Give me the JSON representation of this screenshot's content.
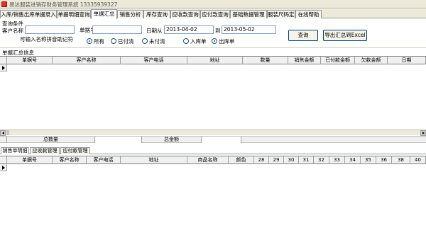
{
  "window": {
    "title": "易达服装进销存财务管理系统 13335939327"
  },
  "tabs": [
    {
      "label": "入库/销售出库单据录入",
      "active": false
    },
    {
      "label": "单据明细查询",
      "active": false
    },
    {
      "label": "单据汇总",
      "active": true
    },
    {
      "label": "销售分析",
      "active": false
    },
    {
      "label": "库存查询",
      "active": false
    },
    {
      "label": "应收款查询",
      "active": false
    },
    {
      "label": "应付款查询",
      "active": false
    },
    {
      "label": "基础数据管理",
      "active": false
    },
    {
      "label": "服装尺码定义",
      "active": false
    },
    {
      "label": "在线帮助",
      "active": false
    }
  ],
  "query": {
    "section_label": "查询条件",
    "customer_label": "客户名称",
    "customer_value": "",
    "customer_hint": "可输入名称拼音助记符",
    "doc_no_label": "单据号",
    "doc_no_value": "",
    "date_from_label": "日期从",
    "date_from_value": "2013-04-02",
    "date_to_label": "到",
    "date_to_value": "2013-05-02",
    "pay_status_options": [
      {
        "label": "所有",
        "selected": true
      },
      {
        "label": "已付清",
        "selected": false
      },
      {
        "label": "未付清",
        "selected": false
      }
    ],
    "doc_type_options": [
      {
        "label": "入库单",
        "selected": false
      },
      {
        "label": "出库单",
        "selected": true
      }
    ],
    "query_button": "查询",
    "export_button": "导出汇总到Excel"
  },
  "summary": {
    "section_label": "单据汇总信息",
    "columns": [
      "单据号",
      "客户名称",
      "客户电话",
      "地址",
      "数量",
      "销售金额",
      "已付款金额",
      "欠款金额",
      "日期"
    ],
    "rows": []
  },
  "totals": {
    "qty_label": "总数量",
    "qty_value": "",
    "amount_label": "总金额",
    "amount_value": ""
  },
  "detail_tabs": [
    {
      "label": "销售单明细",
      "active": true
    },
    {
      "label": "应收款管理",
      "active": false
    },
    {
      "label": "应付款管理",
      "active": false
    }
  ],
  "detail": {
    "columns": [
      "单据号",
      "客户名称",
      "客户电话",
      "地址",
      "商品名称",
      "颜色",
      "28",
      "29",
      "30",
      "31",
      "32",
      "33",
      "34",
      "35",
      "36",
      "38",
      "40"
    ],
    "rows": []
  }
}
